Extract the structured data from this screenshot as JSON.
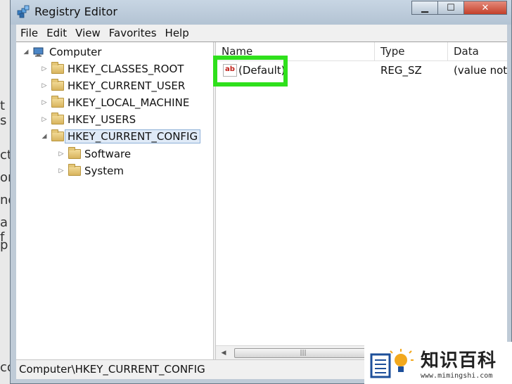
{
  "window": {
    "title": "Registry Editor"
  },
  "caption_buttons": {
    "minimize": "▁",
    "maximize": "☐",
    "close": "✕"
  },
  "menu": [
    "File",
    "Edit",
    "View",
    "Favorites",
    "Help"
  ],
  "tree": {
    "root": "Computer",
    "hives": [
      "HKEY_CLASSES_ROOT",
      "HKEY_CURRENT_USER",
      "HKEY_LOCAL_MACHINE",
      "HKEY_USERS",
      "HKEY_CURRENT_CONFIG"
    ],
    "selected": "HKEY_CURRENT_CONFIG",
    "children": [
      "Software",
      "System"
    ]
  },
  "list": {
    "columns": [
      "Name",
      "Type",
      "Data"
    ],
    "rows": [
      {
        "name": "(Default)",
        "type": "REG_SZ",
        "data": "(value not s"
      }
    ]
  },
  "statusbar": {
    "path": "Computer\\HKEY_CURRENT_CONFIG"
  },
  "background_text": [
    "t s",
    "cte",
    "or",
    "no",
    "a f",
    "p",
    "co"
  ],
  "watermark": {
    "cn": "知识百科",
    "url": "www.mimingshi.com"
  },
  "colors": {
    "highlight": "#2fe01c",
    "title_bar": "#c8d6e4",
    "close_button": "#c4402a"
  }
}
